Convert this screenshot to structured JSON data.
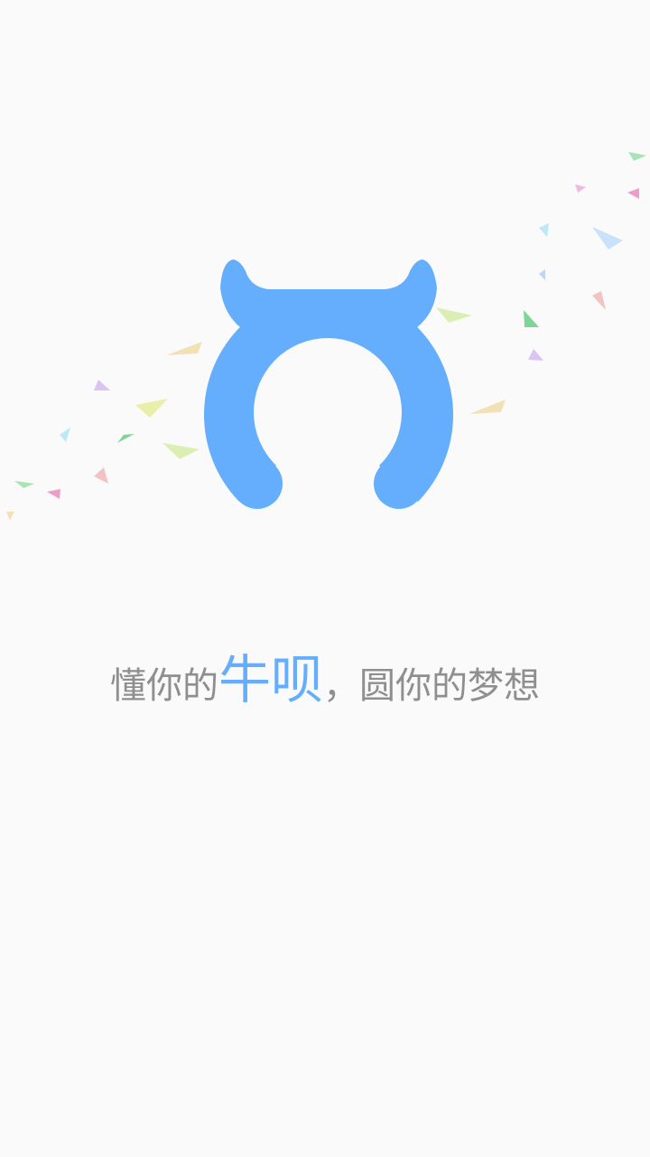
{
  "splash": {
    "slogan": {
      "part1": "懂你的",
      "brand": "牛呗",
      "part2": "，圆你的梦想"
    }
  },
  "icons": {
    "logo": "bull-horn-logo-icon",
    "confetti": "confetti-icon"
  },
  "colors": {
    "background": "#fafafa",
    "brand_blue": "#65adfd",
    "slogan_gray": "#8f8f8f"
  }
}
